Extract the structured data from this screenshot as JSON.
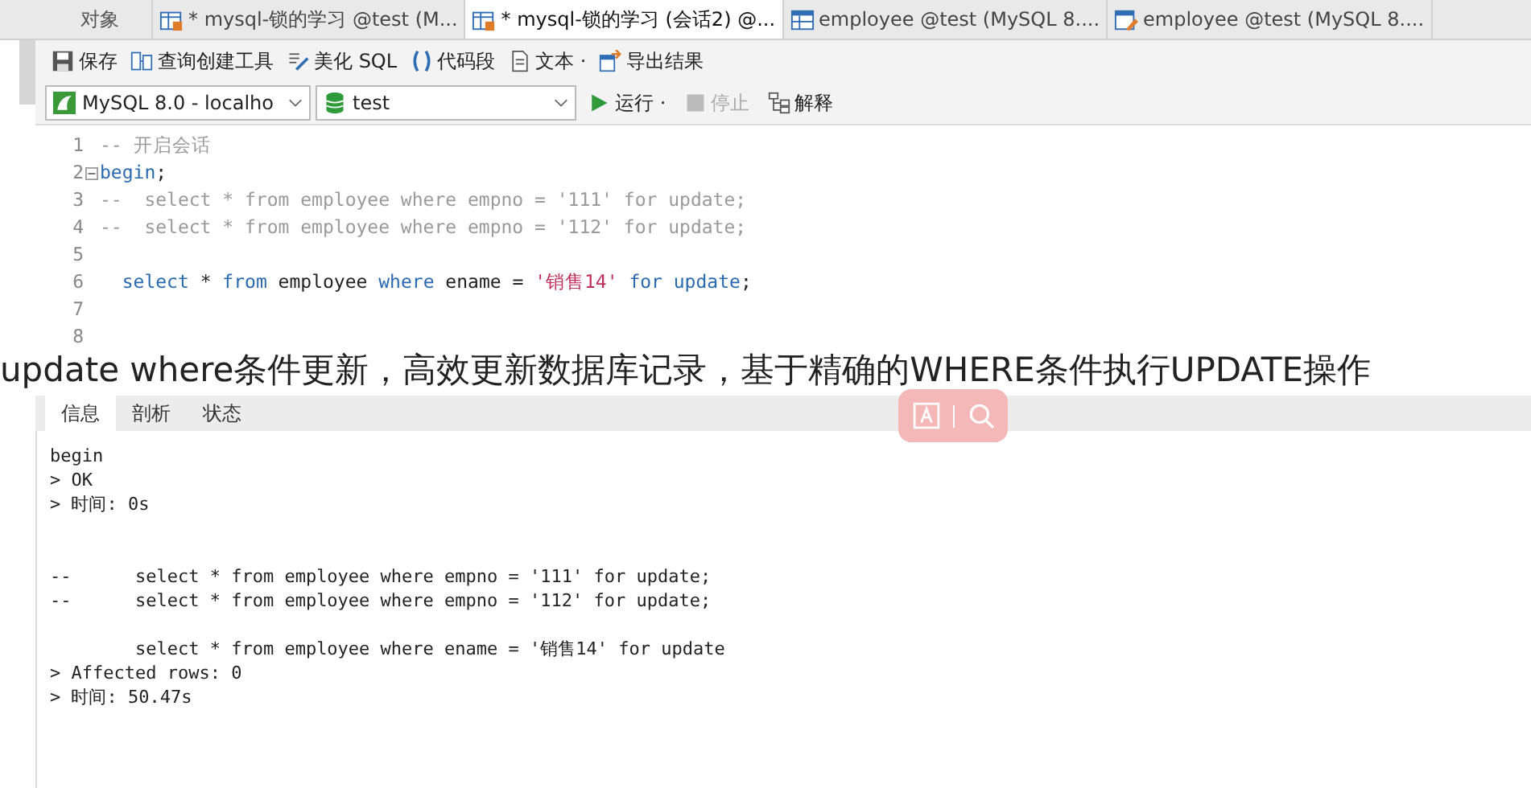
{
  "tabs": [
    {
      "label": "对象",
      "kind": "objects",
      "selected": false
    },
    {
      "label": "* mysql-锁的学习 @test (M...",
      "kind": "query",
      "selected": false
    },
    {
      "label": "* mysql-锁的学习 (会话2) @...",
      "kind": "query",
      "selected": true
    },
    {
      "label": "employee @test (MySQL 8....",
      "kind": "table",
      "selected": false
    },
    {
      "label": "employee @test (MySQL 8....",
      "kind": "table-edit",
      "selected": false
    }
  ],
  "toolbar": [
    {
      "label": "保存",
      "kind": "save"
    },
    {
      "label": "查询创建工具",
      "kind": "builder"
    },
    {
      "label": "美化 SQL",
      "kind": "beautify"
    },
    {
      "label": "代码段",
      "kind": "snippet"
    },
    {
      "label": "文本 ·",
      "kind": "text"
    },
    {
      "label": "导出结果",
      "kind": "export"
    }
  ],
  "connection": {
    "value": "MySQL 8.0 - localho"
  },
  "database": {
    "value": "test"
  },
  "actions": [
    {
      "label": "运行 ·",
      "kind": "run",
      "disabled": false
    },
    {
      "label": "停止",
      "kind": "stop",
      "disabled": true
    },
    {
      "label": "解释",
      "kind": "explain",
      "disabled": false
    }
  ],
  "editor": {
    "lines": [
      {
        "number": "1",
        "fold": false,
        "tokens": [
          {
            "kind": "comment",
            "text": "-- 开启会话"
          }
        ]
      },
      {
        "number": "2",
        "fold": true,
        "tokens": [
          {
            "kind": "keyword",
            "text": "begin"
          },
          {
            "kind": "plain",
            "text": ";"
          }
        ]
      },
      {
        "number": "3",
        "fold": false,
        "tokens": [
          {
            "kind": "comment",
            "text": "--  select * from employee where empno = '111' for update;"
          }
        ]
      },
      {
        "number": "4",
        "fold": false,
        "tokens": [
          {
            "kind": "comment",
            "text": "--  select * from employee where empno = '112' for update;"
          }
        ]
      },
      {
        "number": "5",
        "fold": false
      },
      {
        "number": "6",
        "fold": false,
        "tokens": [
          {
            "kind": "keyword",
            "text": "  select"
          },
          {
            "kind": "plain",
            "text": " * "
          },
          {
            "kind": "keyword",
            "text": "from"
          },
          {
            "kind": "plain",
            "text": " employee "
          },
          {
            "kind": "keyword",
            "text": "where"
          },
          {
            "kind": "plain",
            "text": " ename = "
          },
          {
            "kind": "string",
            "text": "'销售14'"
          },
          {
            "kind": "keyword",
            "text": " for update"
          },
          {
            "kind": "plain",
            "text": ";"
          }
        ]
      },
      {
        "number": "7",
        "fold": false
      },
      {
        "number": "8",
        "fold": false
      }
    ]
  },
  "caption": "update where条件更新，高效更新数据库记录，基于精确的WHERE条件执行UPDATE操作",
  "result_tabs": [
    {
      "label": "信息",
      "selected": true
    },
    {
      "label": "剖析",
      "selected": false
    },
    {
      "label": "状态",
      "selected": false
    }
  ],
  "output": [
    [
      "begin",
      "> OK",
      "> 时间: 0s"
    ],
    [
      "--      select * from employee where empno = '111' for update;",
      "--      select * from employee where empno = '112' for update;"
    ],
    [
      "        select * from employee where ename = '销售14' for update",
      "> Affected rows: 0",
      "> 时间: 50.47s"
    ]
  ]
}
